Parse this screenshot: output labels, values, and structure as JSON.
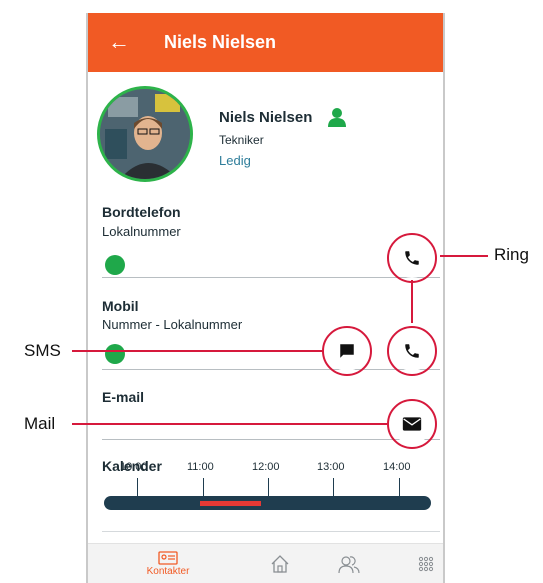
{
  "header": {
    "back_label": "←",
    "title": "Niels Nielsen"
  },
  "contact": {
    "name": "Niels Nielsen",
    "role": "Tekniker",
    "status": "Ledig",
    "status_color": "#1fa84a"
  },
  "sections": {
    "desk_phone": {
      "title": "Bordtelefon",
      "subtitle": "Lokalnummer"
    },
    "mobile": {
      "title": "Mobil",
      "subtitle": "Nummer - Lokalnummer"
    },
    "email": {
      "title": "E-mail"
    },
    "calendar": {
      "title": "Kalender",
      "times": [
        "10:00",
        "11:00",
        "12:00",
        "13:00",
        "14:00"
      ]
    }
  },
  "annotations": {
    "ring": "Ring",
    "sms": "SMS",
    "mail": "Mail"
  },
  "bottom_nav": {
    "contacts_label": "Kontakter"
  },
  "colors": {
    "accent": "#f15a24",
    "annotation": "#d6193c",
    "timeline": "#1f3d4f",
    "busy": "#e53935"
  }
}
